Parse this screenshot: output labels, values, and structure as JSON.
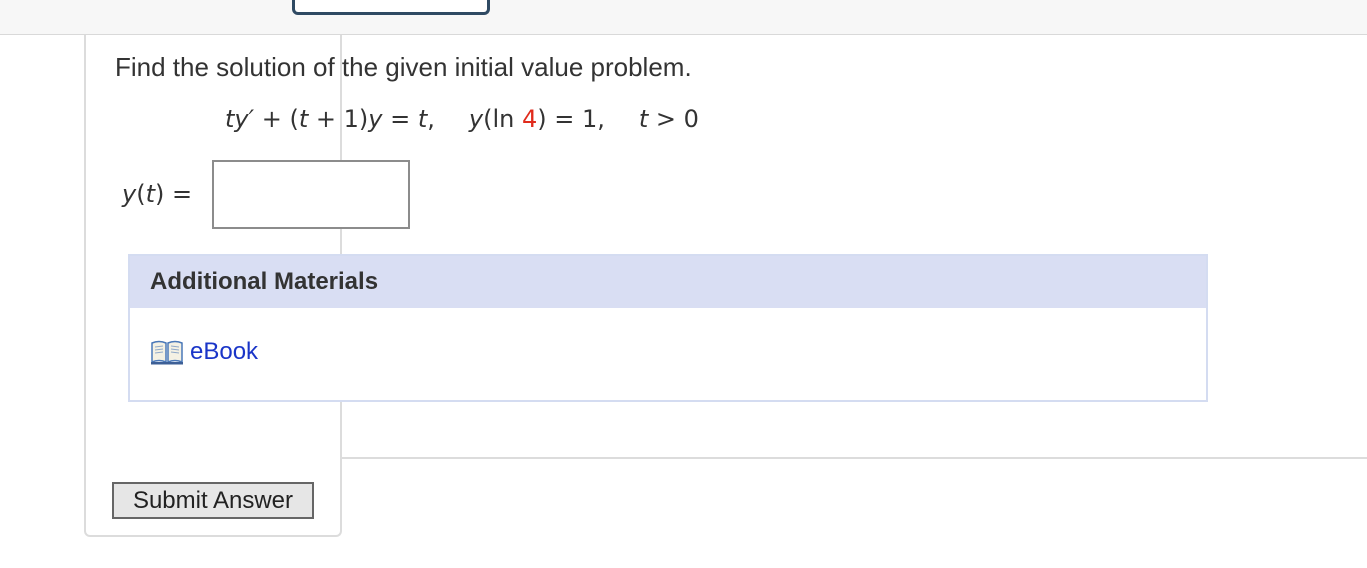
{
  "question": {
    "prompt": "Find the solution of the given initial value problem.",
    "equation": {
      "lhs_t": "t",
      "lhs_y_prime": "y′",
      "plus1": " + (",
      "t2": "t",
      "plus_one": " + 1)",
      "y1": "y",
      "equals_t": " = ",
      "t3": "t",
      "comma1": ",",
      "y_ic": "y",
      "ln_open": "(ln ",
      "ic_value": "4",
      "ln_close": ") = 1,",
      "t_cond": "t",
      "cond_rest": " > 0"
    },
    "answer_label_y": "y",
    "answer_label_paren_open": "(",
    "answer_label_t": "t",
    "answer_label_rest": ")  =",
    "answer_value": ""
  },
  "additional_materials": {
    "title": "Additional Materials",
    "ebook_label": "eBook",
    "ebook_icon": "open-book-icon"
  },
  "submit": {
    "label": "Submit Answer"
  },
  "colors": {
    "header_bg": "#d9def3",
    "link": "#1a35c8",
    "highlight_red": "#e02b1c",
    "tab_border": "#2f4a63"
  }
}
